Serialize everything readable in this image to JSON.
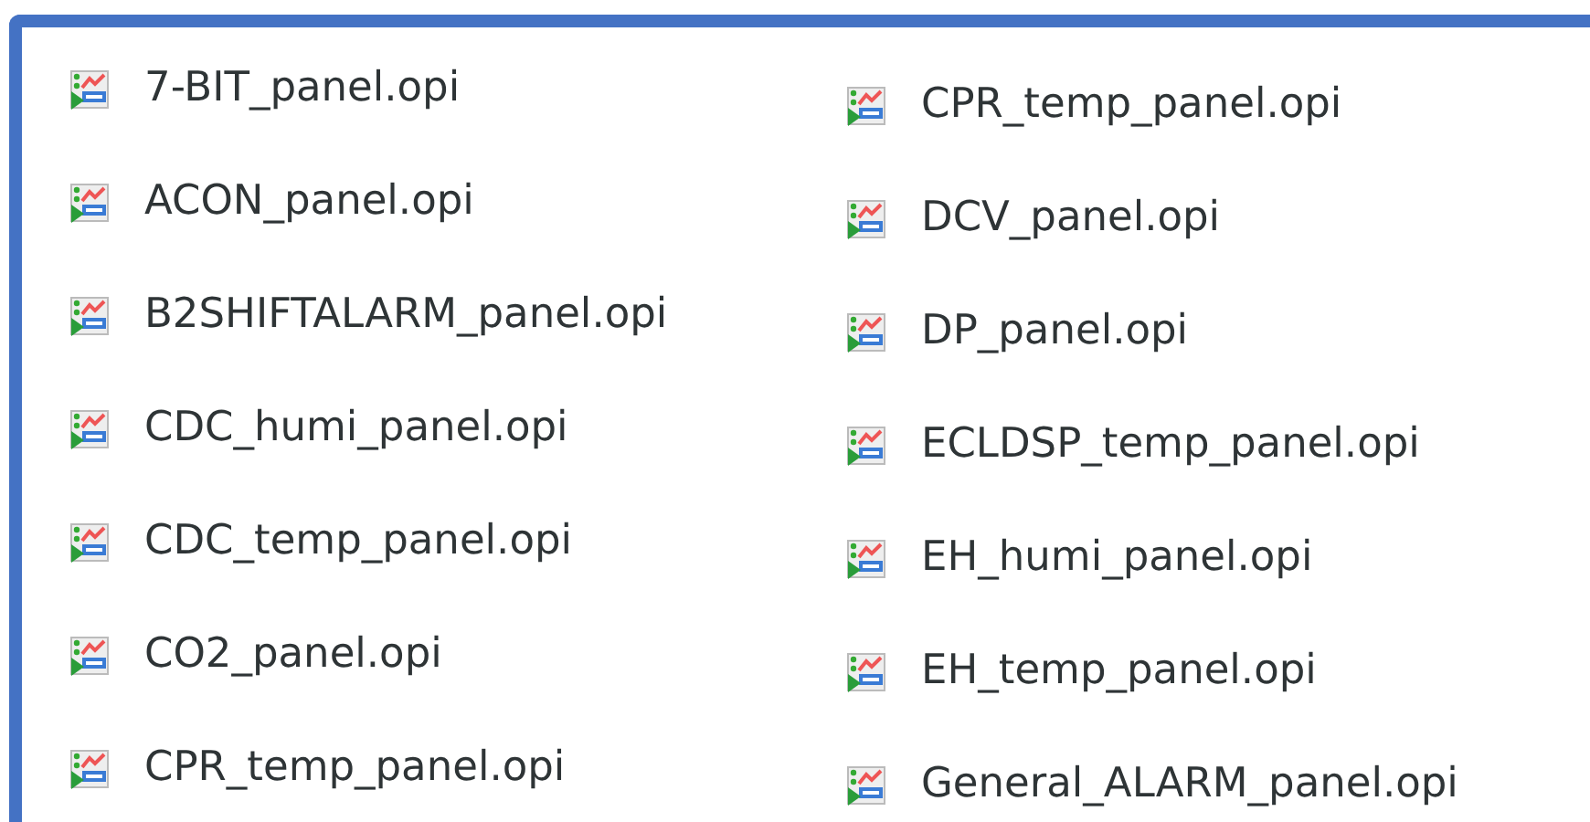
{
  "columns": [
    {
      "files": [
        {
          "name": "7-BIT_panel.opi"
        },
        {
          "name": "ACON_panel.opi"
        },
        {
          "name": "B2SHIFTALARM_panel.opi"
        },
        {
          "name": "CDC_humi_panel.opi"
        },
        {
          "name": "CDC_temp_panel.opi"
        },
        {
          "name": "CO2_panel.opi"
        },
        {
          "name": "CPR_temp_panel.opi"
        }
      ]
    },
    {
      "files": [
        {
          "name": "CPR_temp_panel.opi"
        },
        {
          "name": "DCV_panel.opi"
        },
        {
          "name": "DP_panel.opi"
        },
        {
          "name": "ECLDSP_temp_panel.opi"
        },
        {
          "name": "EH_humi_panel.opi"
        },
        {
          "name": "EH_temp_panel.opi"
        },
        {
          "name": "General_ALARM_panel.opi"
        }
      ]
    }
  ]
}
